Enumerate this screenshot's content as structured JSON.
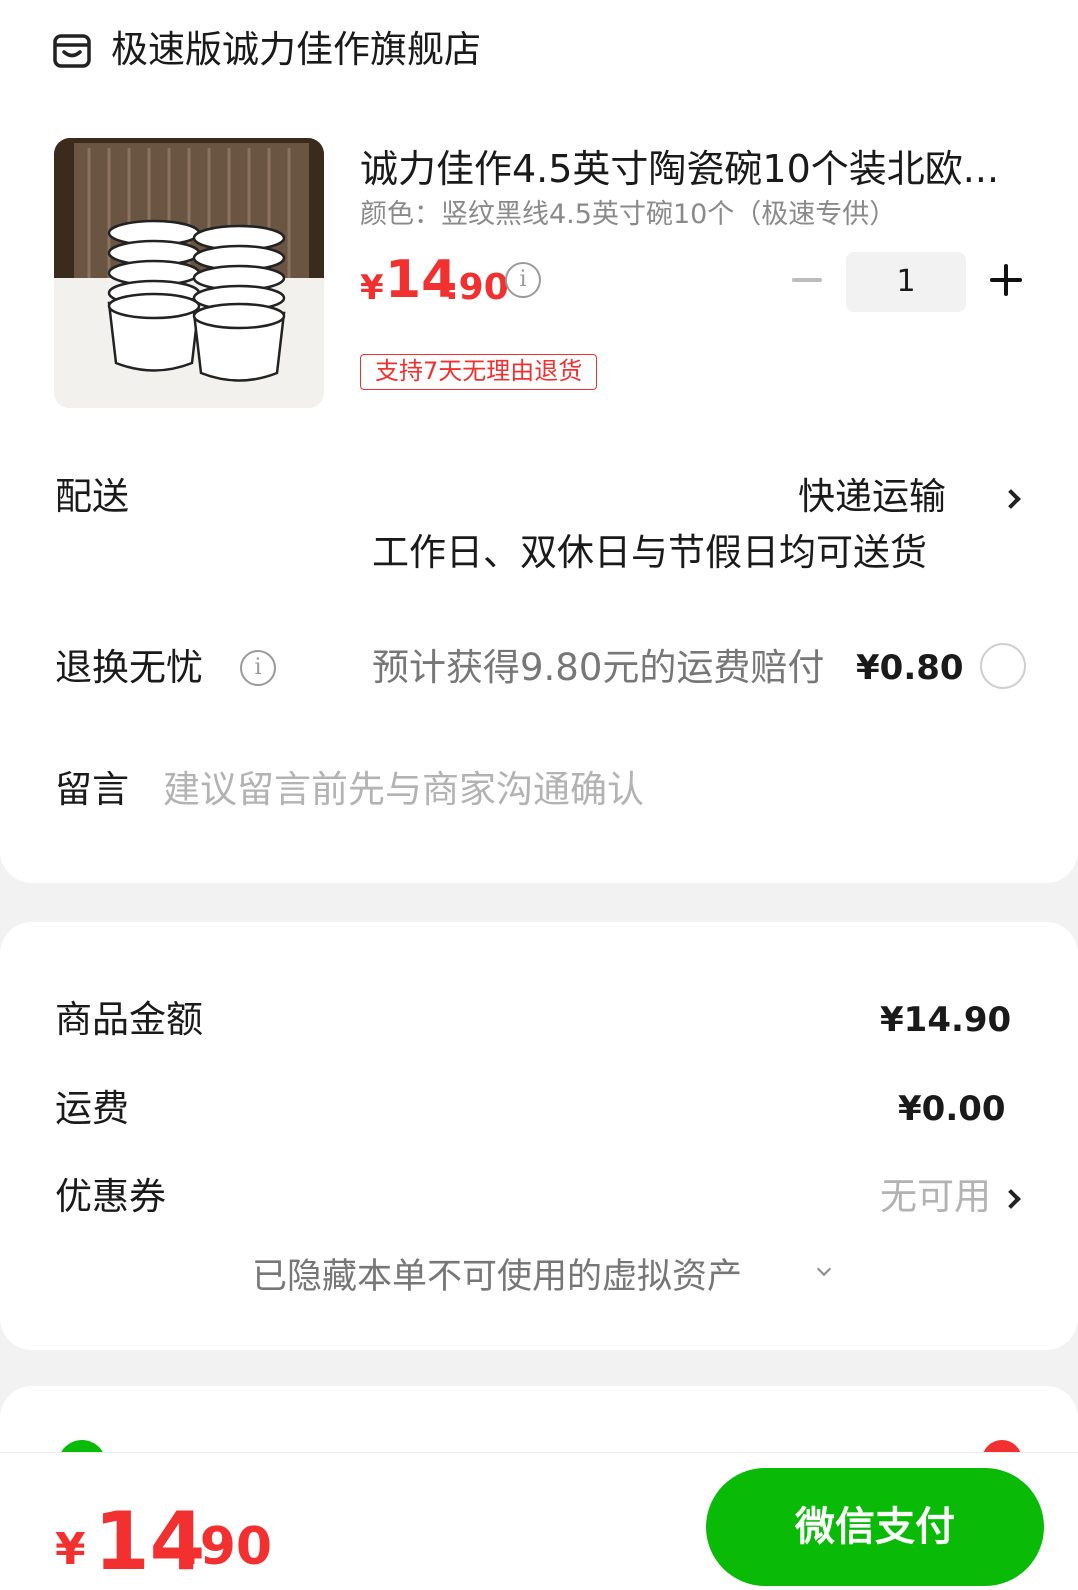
{
  "store": {
    "name": "极速版诚力佳作旗舰店",
    "icon": "store-icon"
  },
  "product": {
    "title": "诚力佳作4.5英寸陶瓷碗10个装北欧...",
    "spec": "颜色：竖纹黑线4.5英寸碗10个（极速专供）",
    "price_symbol": "¥",
    "price_int": "14",
    "price_dec": ".90",
    "quantity": "1",
    "badge": "支持7天无理由退货",
    "accent_color": "#f2302f"
  },
  "delivery": {
    "label": "配送",
    "method": "快递运输",
    "note": "工作日、双休日与节假日均可送货"
  },
  "return_insurance": {
    "label": "退换无忧",
    "desc": "预计获得9.80元的运费赔付",
    "price": "¥0.80",
    "selected": false
  },
  "message": {
    "label": "留言",
    "placeholder": "建议留言前先与商家沟通确认"
  },
  "summary": {
    "items_label": "商品金额",
    "items_value": "¥14.90",
    "shipping_label": "运费",
    "shipping_value": "¥0.00",
    "coupon_label": "优惠券",
    "coupon_value": "无可用",
    "hidden_assets": "已隐藏本单不可使用的虚拟资产"
  },
  "footer": {
    "total_symbol": "¥",
    "total_int": "14",
    "total_dec": ".90",
    "pay_label": "微信支付",
    "pay_color": "#09bb07"
  }
}
